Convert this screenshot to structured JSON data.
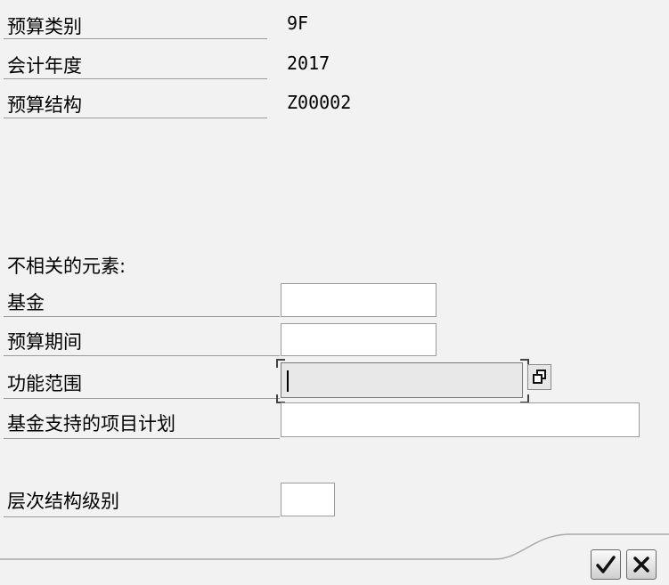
{
  "header_fields": [
    {
      "label": "预算类别",
      "value": "9F"
    },
    {
      "label": "会计年度",
      "value": "2017"
    },
    {
      "label": "预算结构",
      "value": "Z00002"
    }
  ],
  "irrelevant_section": {
    "title": "不相关的元素:",
    "fields": [
      {
        "label": "基金",
        "value": ""
      },
      {
        "label": "预算期间",
        "value": ""
      },
      {
        "label": "功能范围",
        "value": ""
      },
      {
        "label": "基金支持的项目计划",
        "value": ""
      }
    ]
  },
  "hierarchy_field": {
    "label": "层次结构级别",
    "value": ""
  },
  "buttons": {
    "confirm_icon": "check-icon",
    "cancel_icon": "cancel-icon"
  }
}
